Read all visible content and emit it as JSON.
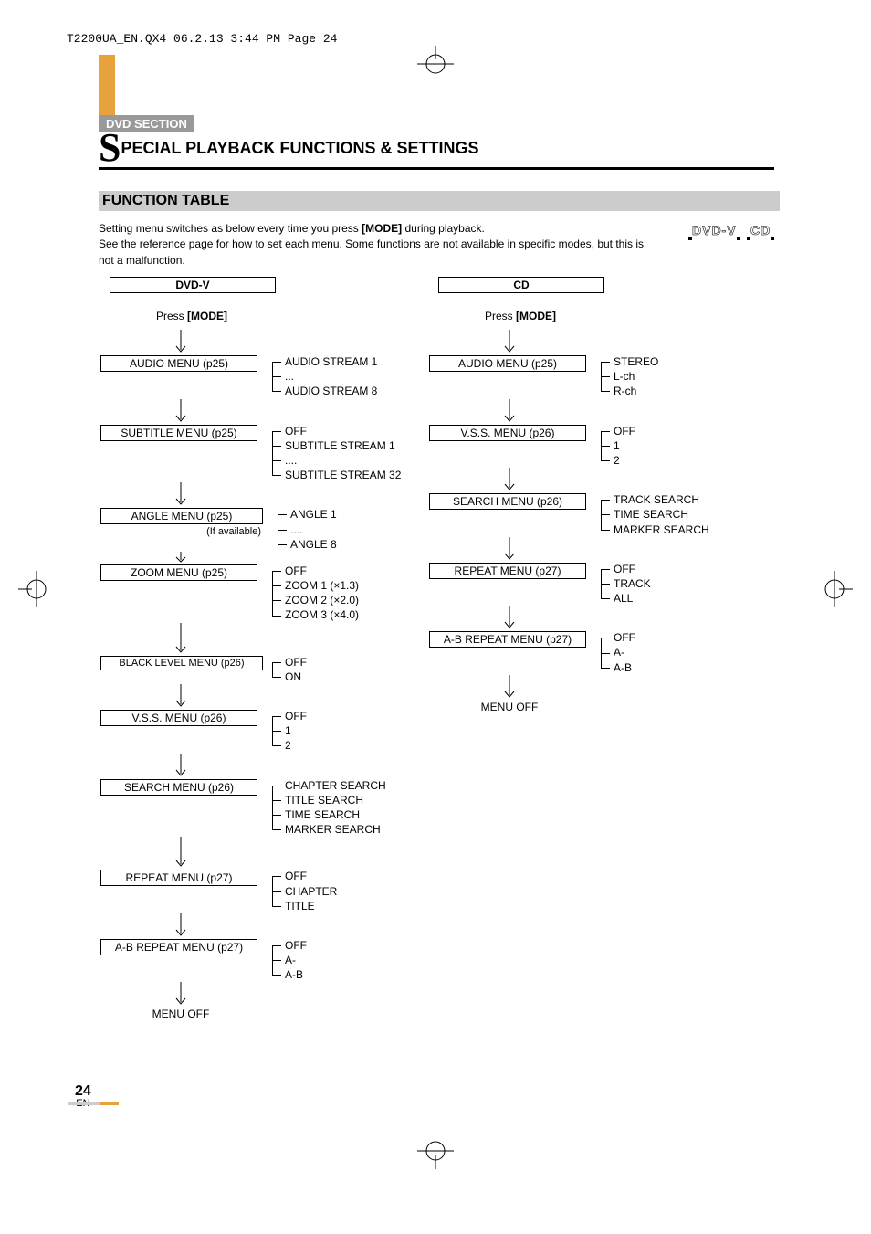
{
  "header_text": "T2200UA_EN.QX4  06.2.13  3:44 PM  Page 24",
  "section_tag": "DVD SECTION",
  "title_s": "S",
  "title_rest": "PECIAL PLAYBACK FUNCTIONS & SETTINGS",
  "subheading": "FUNCTION TABLE",
  "intro_before_mode": "Setting menu switches as below every time you press ",
  "intro_mode": "[MODE]",
  "intro_after_mode": " during playback.",
  "intro_line2": "See the reference page for how to set each menu. Some functions are not available in specific modes, but this is not a malfunction.",
  "icons": {
    "dvdv": "DVD-V",
    "cd": "CD"
  },
  "press_before": "Press ",
  "press_bold": "[MODE]",
  "menu_off": "MENU OFF",
  "if_available": "(If available)",
  "dvdv": {
    "disc": "DVD-V",
    "audio": {
      "label": "AUDIO MENU (p25)",
      "opts": [
        "AUDIO STREAM 1",
        "...",
        "AUDIO STREAM 8"
      ]
    },
    "subtitle": {
      "label": "SUBTITLE MENU (p25)",
      "opts": [
        "OFF",
        "SUBTITLE STREAM 1",
        "....",
        "SUBTITLE STREAM 32"
      ]
    },
    "angle": {
      "label": "ANGLE MENU (p25)",
      "opts": [
        "ANGLE 1",
        "....",
        "ANGLE 8"
      ]
    },
    "zoom": {
      "label": "ZOOM MENU (p25)",
      "opts": [
        "OFF",
        "ZOOM 1 (×1.3)",
        "ZOOM 2 (×2.0)",
        "ZOOM 3 (×4.0)"
      ]
    },
    "black": {
      "label": "BLACK LEVEL MENU (p26)",
      "opts": [
        "OFF",
        "ON"
      ]
    },
    "vss": {
      "label": "V.S.S. MENU (p26)",
      "opts": [
        "OFF",
        "1",
        "2"
      ]
    },
    "search": {
      "label": "SEARCH MENU (p26)",
      "opts": [
        "CHAPTER SEARCH",
        "TITLE SEARCH",
        "TIME SEARCH",
        "MARKER SEARCH"
      ]
    },
    "repeat": {
      "label": "REPEAT MENU (p27)",
      "opts": [
        "OFF",
        "CHAPTER",
        "TITLE"
      ]
    },
    "ab": {
      "label": "A-B REPEAT MENU (p27)",
      "opts": [
        "OFF",
        "A-",
        "A-B"
      ]
    }
  },
  "cd": {
    "disc": "CD",
    "audio": {
      "label": "AUDIO MENU (p25)",
      "opts": [
        "STEREO",
        "L-ch",
        "R-ch"
      ]
    },
    "vss": {
      "label": "V.S.S. MENU (p26)",
      "opts": [
        "OFF",
        "1",
        "2"
      ]
    },
    "search": {
      "label": "SEARCH MENU (p26)",
      "opts": [
        "TRACK SEARCH",
        "TIME SEARCH",
        "MARKER SEARCH"
      ]
    },
    "repeat": {
      "label": "REPEAT MENU (p27)",
      "opts": [
        "OFF",
        "TRACK",
        "ALL"
      ]
    },
    "ab": {
      "label": "A-B REPEAT MENU (p27)",
      "opts": [
        "OFF",
        "A-",
        "A-B"
      ]
    }
  },
  "page_number": "24",
  "page_lang": "EN"
}
